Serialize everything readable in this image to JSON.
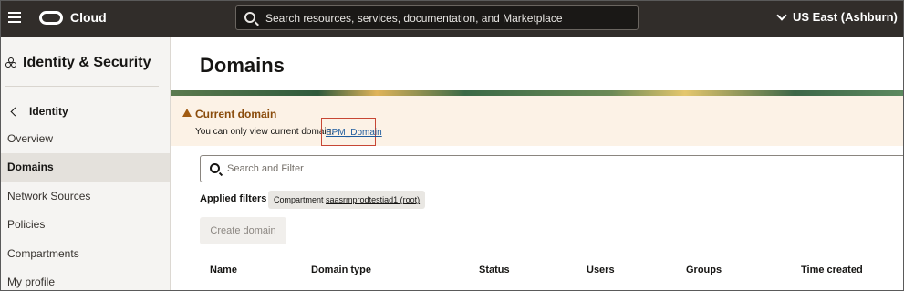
{
  "topbar": {
    "brand": "Cloud",
    "search_placeholder": "Search resources, services, documentation, and Marketplace",
    "region": "US East (Ashburn)"
  },
  "sidebar": {
    "title": "Identity & Security",
    "back_label": "Identity",
    "items": [
      {
        "label": "Overview",
        "active": false
      },
      {
        "label": "Domains",
        "active": true
      },
      {
        "label": "Network Sources",
        "active": false
      },
      {
        "label": "Policies",
        "active": false
      },
      {
        "label": "Compartments",
        "active": false
      },
      {
        "label": "My profile",
        "active": false
      }
    ]
  },
  "main": {
    "page_title": "Domains",
    "alert": {
      "title": "Current domain",
      "message": "You can only view current domain.",
      "link": "EPM_Domain"
    },
    "filter_placeholder": "Search and Filter",
    "applied_filters_label": "Applied filters",
    "filter_chip": {
      "prefix": "Compartment",
      "value": "saasrmprodtestiad1 (root)"
    },
    "create_button": "Create domain",
    "table": {
      "columns": [
        "Name",
        "Domain type",
        "Status",
        "Users",
        "Groups",
        "Time created"
      ]
    }
  },
  "colors": {
    "topbar_bg": "#312d2a",
    "warning": "#a15b12",
    "link": "#1e5c9e",
    "highlight_border": "#c74634"
  }
}
